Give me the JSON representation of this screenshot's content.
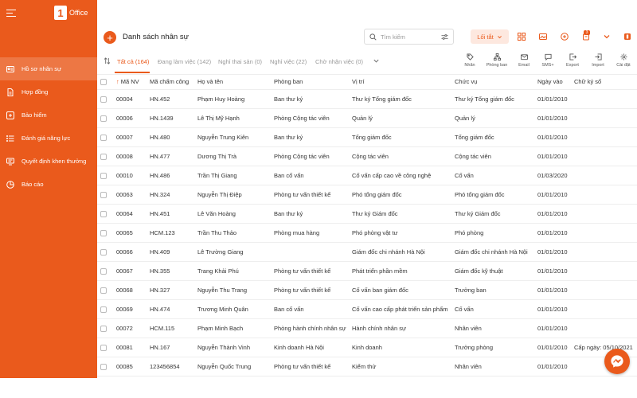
{
  "brand": {
    "logo_mark": "1",
    "logo_text": "Office"
  },
  "sidebar": {
    "items": [
      {
        "label": "Hồ sơ nhân sự",
        "icon": "id-card-icon"
      },
      {
        "label": "Hợp đồng",
        "icon": "document-icon"
      },
      {
        "label": "Bảo hiểm",
        "icon": "plus-square-icon"
      },
      {
        "label": "Đánh giá năng lực",
        "icon": "list-icon"
      },
      {
        "label": "Quyết định khen thưởng",
        "icon": "award-icon"
      },
      {
        "label": "Báo cáo",
        "icon": "pie-chart-icon"
      }
    ]
  },
  "header": {
    "add_label": "+",
    "title": "Danh sách nhân sự",
    "search_placeholder": "Tìm kiếm",
    "filter_label": "Lối tắt",
    "notification_count": "3"
  },
  "tabs": [
    {
      "label": "Tất cả (164)"
    },
    {
      "label": "Đang làm việc (142)"
    },
    {
      "label": "Nghỉ thai sản (0)"
    },
    {
      "label": "Nghỉ việc (22)"
    },
    {
      "label": "Chờ nhận việc (0)"
    }
  ],
  "actions": [
    {
      "label": "Nhãn",
      "icon": "tag-icon"
    },
    {
      "label": "Phòng ban",
      "icon": "org-chart-icon"
    },
    {
      "label": "Email",
      "icon": "mail-icon"
    },
    {
      "label": "SMS+",
      "icon": "chat-icon"
    },
    {
      "label": "Export",
      "icon": "export-icon"
    },
    {
      "label": "Import",
      "icon": "import-icon"
    },
    {
      "label": "Cài đặt",
      "icon": "gear-icon"
    }
  ],
  "table": {
    "sort_arrow": "↑",
    "columns": [
      "Mã NV",
      "Mã chấm công",
      "Họ và tên",
      "Phòng ban",
      "Vị trí",
      "Chức vụ",
      "Ngày vào",
      "Chữ ký số"
    ],
    "rows": [
      [
        "00004",
        "HN.452",
        "Phạm Huy Hoàng",
        "Ban thư ký",
        "Thư ký Tổng giám đốc",
        "Thư ký Tổng giám đốc",
        "01/01/2010",
        ""
      ],
      [
        "00006",
        "HN.1439",
        "Lê Thị Mỹ Hạnh",
        "Phòng Cộng tác viên",
        "Quản lý",
        "Quản lý",
        "01/01/2010",
        ""
      ],
      [
        "00007",
        "HN.480",
        "Nguyễn Trung Kiên",
        "Ban thư ký",
        "Tổng giám đốc",
        "Tổng giám đốc",
        "01/01/2010",
        ""
      ],
      [
        "00008",
        "HN.477",
        "Dương Thị Trà",
        "Phòng Cộng tác viên",
        "Cộng tác viên",
        "Cộng tác viên",
        "01/01/2010",
        ""
      ],
      [
        "00010",
        "HN.486",
        "Trần Thị Giang",
        "Ban cố vấn",
        "Cố vấn cấp cao về công nghệ",
        "Cố vấn",
        "01/03/2020",
        ""
      ],
      [
        "00063",
        "HN.324",
        "Nguyễn Thị Điệp",
        "Phòng tư vấn thiết kế",
        "Phó tổng giám đốc",
        "Phó tổng giám đốc",
        "01/01/2010",
        ""
      ],
      [
        "00064",
        "HN.451",
        "Lê Văn Hoàng",
        "Ban thư ký",
        "Thư ký Giám đốc",
        "Thư ký Giám đốc",
        "01/01/2010",
        ""
      ],
      [
        "00065",
        "HCM.123",
        "Trần Thu Thảo",
        "Phòng mua hàng",
        "Phó phòng vật tư",
        "Phó phòng",
        "01/01/2010",
        ""
      ],
      [
        "00066",
        "HN.409",
        "Lê Trường Giang",
        "",
        "Giám đốc chi nhánh Hà Nội",
        "Giám đốc chi nhánh Hà Nội",
        "01/01/2010",
        ""
      ],
      [
        "00067",
        "HN.355",
        "Trang Khải Phú",
        "Phòng tư vấn thiết kế",
        "Phát triển phần mềm",
        "Giám đốc kỹ thuật",
        "01/01/2010",
        ""
      ],
      [
        "00068",
        "HN.327",
        "Nguyễn Thu Trang",
        "Phòng tư vấn thiết kế",
        "Cố vấn ban giám đốc",
        "Trưởng ban",
        "01/01/2010",
        ""
      ],
      [
        "00069",
        "HN.474",
        "Trương Minh Quân",
        "Ban cố vấn",
        "Cố vấn cao cấp phát triển sản phẩm",
        "Cố vấn",
        "01/01/2010",
        ""
      ],
      [
        "00072",
        "HCM.115",
        "Phạm Minh Bạch",
        "Phòng hành chính nhân sự",
        "Hành chính nhân sự",
        "Nhân viên",
        "01/01/2010",
        ""
      ],
      [
        "00081",
        "HN.167",
        "Nguyễn Thành Vinh",
        "Kinh doanh Hà Nội",
        "Kinh doanh",
        "Trưởng phòng",
        "01/01/2010",
        "Cấp ngày: 05/10/2021"
      ],
      [
        "00085",
        "123456854",
        "Nguyễn Quốc Trung",
        "Phòng tư vấn thiết kế",
        "Kiểm thử",
        "Nhân viên",
        "01/01/2010",
        ""
      ]
    ]
  },
  "colors": {
    "accent": "#ea5a1c",
    "accent_light": "#fde8df"
  }
}
